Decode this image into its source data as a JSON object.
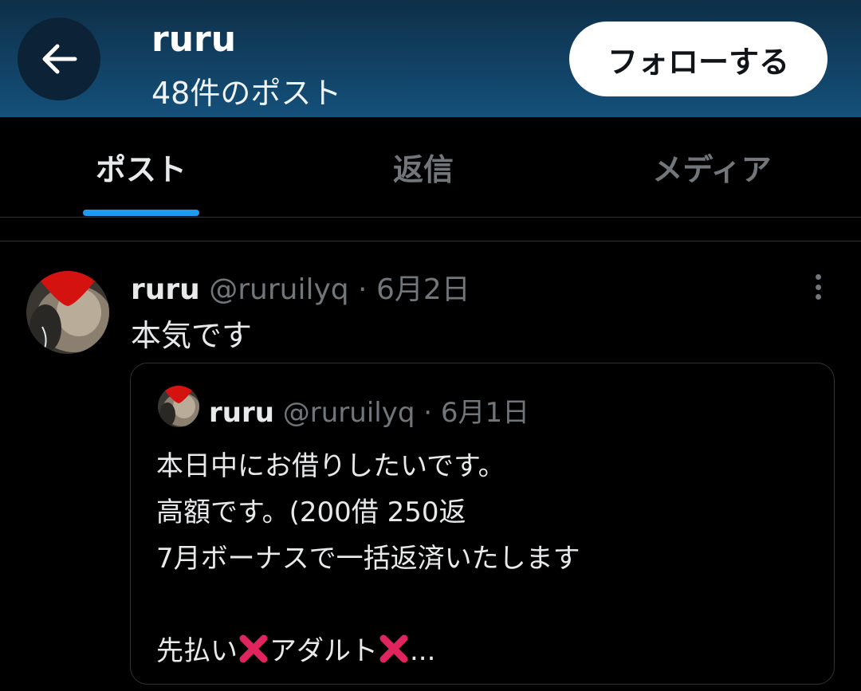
{
  "header": {
    "back_icon": "arrow-left-icon",
    "name": "ruru",
    "post_count": "48件のポスト",
    "follow_label": "フォローする"
  },
  "tabs": [
    {
      "label": "ポスト",
      "active": true
    },
    {
      "label": "返信",
      "active": false
    },
    {
      "label": "メディア",
      "active": false
    }
  ],
  "post": {
    "display_name": "ruru",
    "handle_date": "@ruruilyq · 6月2日",
    "text": "本気です",
    "more_icon": "more-vertical-icon",
    "quote": {
      "display_name": "ruru",
      "handle_date": "@ruruilyq · 6月1日",
      "lines": [
        "本日中にお借りしたいです。",
        "高額です。(200借 250返",
        "7月ボーナスで一括返済いたします",
        ""
      ],
      "last_line": {
        "part1": "先払い",
        "part2": "アダルト",
        "part3": "..."
      },
      "emoji_icon": "cross-mark-icon"
    }
  },
  "colors": {
    "accent": "#1d9bf0",
    "header_top": "#0e2f48",
    "header_bottom": "#14507a",
    "cross_mark": "#e0245e"
  }
}
